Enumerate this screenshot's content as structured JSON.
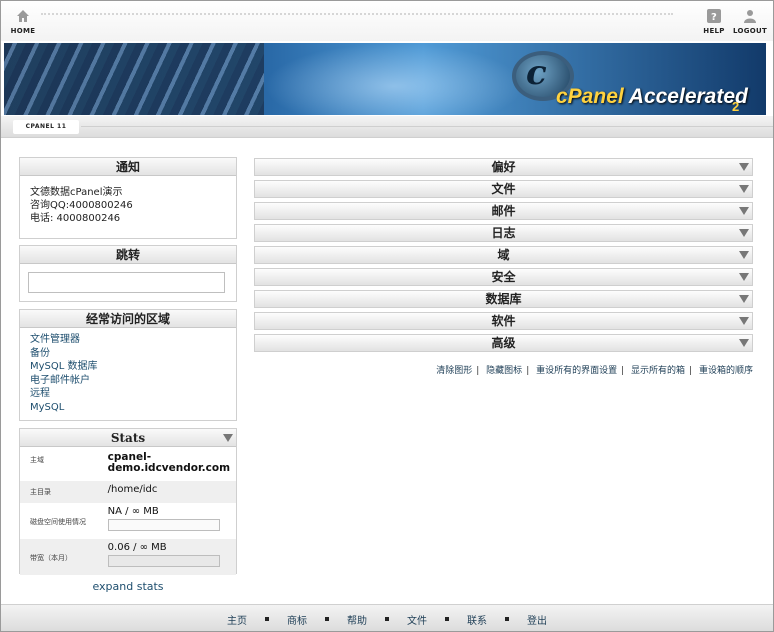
{
  "toolbar": {
    "home_label": "HOME",
    "help_label": "HELP",
    "logout_label": "LOGOUT"
  },
  "banner": {
    "logo_c": "c",
    "logo_cpanel": "cPanel",
    "logo_accelerated": "Accelerated",
    "logo_version": "2"
  },
  "version_tab": "CPANEL 11",
  "notice": {
    "title": "通知",
    "lines": [
      "文德数据cPanel演示",
      "咨询QQ:4000800246",
      "电话: 4000800246"
    ]
  },
  "jump": {
    "title": "跳转",
    "value": ""
  },
  "frequent": {
    "title": "经常访问的区域",
    "items": [
      "文件管理器",
      "备份",
      "MySQL 数据库",
      "电子邮件帐户",
      "远程",
      "MySQL"
    ]
  },
  "stats": {
    "title": "Stats",
    "rows": [
      {
        "label": "主域",
        "value": "cpanel-demo.idcvendor.com"
      },
      {
        "label": "主目录",
        "value": "/home/idc"
      },
      {
        "label": "磁盘空间使用情况",
        "value": "NA / ∞ MB"
      },
      {
        "label": "带宽（本月）",
        "value": "0.06 / ∞ MB"
      }
    ],
    "expand_label": "expand stats"
  },
  "sections": [
    "偏好",
    "文件",
    "邮件",
    "日志",
    "域",
    "安全",
    "数据库",
    "软件",
    "高级"
  ],
  "view_links": [
    "清除图形",
    "隐藏图标",
    "重设所有的界面设置",
    "显示所有的箱",
    "重设箱的顺序"
  ],
  "footer": {
    "links": [
      "主页",
      "商标",
      "帮助",
      "文件",
      "联系",
      "登出"
    ]
  }
}
